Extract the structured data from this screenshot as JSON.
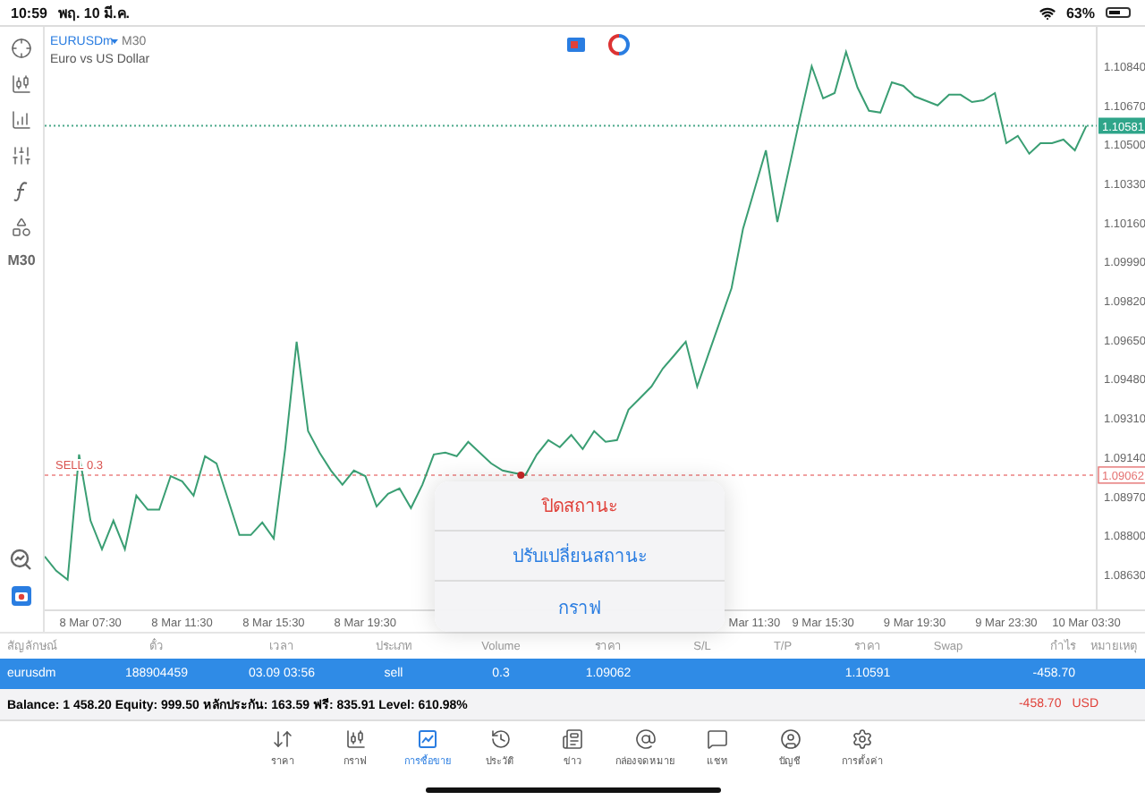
{
  "status_bar": {
    "time": "10:59",
    "date": "พฤ. 10 มี.ค.",
    "battery": "63%"
  },
  "toolbar": {
    "timeframe": "M30"
  },
  "chart": {
    "symbol": "EURUSDm",
    "timeframe": "M30",
    "description": "Euro vs US Dollar",
    "order_line": {
      "label": "SELL 0.3",
      "price": "1.09062"
    },
    "price_badge": "1.10581",
    "chart_data": {
      "type": "line",
      "categories": [
        null,
        null,
        null,
        null,
        "8 Mar 07:30",
        null,
        null,
        null,
        null,
        null,
        null,
        null,
        "8 Mar 11:30",
        null,
        null,
        null,
        null,
        null,
        null,
        null,
        "8 Mar 15:30",
        null,
        null,
        null,
        null,
        null,
        null,
        null,
        "8 Mar 19:30",
        null,
        null,
        null,
        null,
        null,
        null,
        null,
        null,
        null,
        null,
        null,
        null,
        null,
        null,
        null,
        null,
        null,
        null,
        null,
        null,
        null,
        null,
        null,
        null,
        null,
        null,
        null,
        null,
        null,
        null,
        null,
        null,
        null,
        "Mar 11:30",
        null,
        null,
        null,
        null,
        null,
        "9 Mar 15:30",
        null,
        null,
        null,
        null,
        null,
        null,
        null,
        "9 Mar 19:30",
        null,
        null,
        null,
        null,
        null,
        null,
        null,
        "9 Mar 23:30",
        null,
        null,
        null,
        null,
        null,
        null,
        "10 Mar 03:30"
      ],
      "ref_lines": [
        {
          "axis": "y",
          "value": 1.10581,
          "color": "#4aa88a"
        },
        {
          "axis": "y",
          "value": 1.09062,
          "color": "#f0a0a0"
        }
      ],
      "series": [
        {
          "color": "#3a9e73",
          "values": [
            1.08708,
            1.08646,
            1.08607,
            1.09152,
            1.08864,
            1.08739,
            1.08864,
            1.08739,
            1.08973,
            1.08911,
            1.08911,
            1.09058,
            1.09035,
            1.08973,
            1.09144,
            1.09113,
            1.08957,
            1.08802,
            1.08802,
            1.08856,
            1.08786,
            1.09175,
            1.09642,
            1.09253,
            1.0916,
            1.09082,
            1.0902,
            1.09082,
            1.09058,
            1.08926,
            1.08981,
            1.09004,
            1.08918,
            1.0902,
            1.09152,
            1.0916,
            1.09144,
            1.09206,
            1.0916,
            1.09113,
            1.09082,
            1.09072,
            1.09062,
            1.09152,
            1.09214,
            1.09183,
            1.09237,
            1.09175,
            1.09253,
            1.09206,
            1.09214,
            1.09346,
            1.09396,
            1.09447,
            1.09525,
            1.09583,
            1.09642,
            1.09447,
            1.0959,
            1.09732,
            1.09875,
            1.10132,
            1.10303,
            1.10474,
            1.10163,
            1.10391,
            1.1062,
            1.1084,
            1.107,
            1.10723,
            1.10902,
            1.10747,
            1.10646,
            1.10638,
            1.1077,
            1.10754,
            1.10708,
            1.10689,
            1.10669,
            1.10716,
            1.10716,
            1.10684,
            1.10692,
            1.10723,
            1.10505,
            1.10537,
            1.10459,
            1.10505,
            1.10505,
            1.10521,
            1.10474,
            1.10581
          ]
        }
      ],
      "ylim": [
        1.08474,
        1.11011
      ],
      "yticks": [
        {
          "value": 1.1084,
          "label": "1.10840"
        },
        {
          "value": 1.1067,
          "label": "1.10670"
        },
        {
          "value": 1.105,
          "label": "1.10500"
        },
        {
          "value": 1.1033,
          "label": "1.10330"
        },
        {
          "value": 1.1016,
          "label": "1.10160"
        },
        {
          "value": 1.0999,
          "label": "1.09990"
        },
        {
          "value": 1.0982,
          "label": "1.09820"
        },
        {
          "value": 1.0965,
          "label": "1.09650"
        },
        {
          "value": 1.0948,
          "label": "1.09480"
        },
        {
          "value": 1.0931,
          "label": "1.09310"
        },
        {
          "value": 1.0914,
          "label": "1.09140"
        },
        {
          "value": 1.0897,
          "label": "1.08970"
        },
        {
          "value": 1.088,
          "label": "1.08800"
        },
        {
          "value": 1.0863,
          "label": "1.08630"
        }
      ]
    }
  },
  "context_menu": [
    {
      "label": "ปิดสถานะ",
      "kind": "destructive"
    },
    {
      "label": "ปรับเปลี่ยนสถานะ",
      "kind": "action"
    },
    {
      "label": "กราฟ",
      "kind": "action"
    }
  ],
  "positions": {
    "columns": [
      "สัญลักษณ์",
      "ตั๋ว",
      "เวลา",
      "ประเภท",
      "Volume",
      "ราคา",
      "S/L",
      "T/P",
      "ราคา",
      "Swap",
      "กำไร",
      "หมายเหตุ"
    ],
    "rows": [
      {
        "selected": true,
        "symbol": "eurusdm",
        "ticket": "188904459",
        "time": "03.09 03:56",
        "type": "sell",
        "volume": "0.3",
        "price": "1.09062",
        "current_price": "1.10591",
        "profit": "-458.70"
      }
    ]
  },
  "summary": {
    "text": "Balance: 1 458.20 Equity: 999.50 หลักประกัน: 163.59 ฟรี: 835.91 Level: 610.98%",
    "profit": "-458.70",
    "currency": "USD"
  },
  "tab_bar": [
    {
      "label": "ราคา",
      "selected": false
    },
    {
      "label": "กราฟ",
      "selected": false
    },
    {
      "label": "การซื้อขาย",
      "selected": true
    },
    {
      "label": "ประวัติ",
      "selected": false
    },
    {
      "label": "ข่าว",
      "selected": false
    },
    {
      "label": "กล่องจดหมาย",
      "selected": false
    },
    {
      "label": "แชท",
      "selected": false
    },
    {
      "label": "บัญชี",
      "selected": false
    },
    {
      "label": "การตั้งค่า",
      "selected": false
    }
  ]
}
